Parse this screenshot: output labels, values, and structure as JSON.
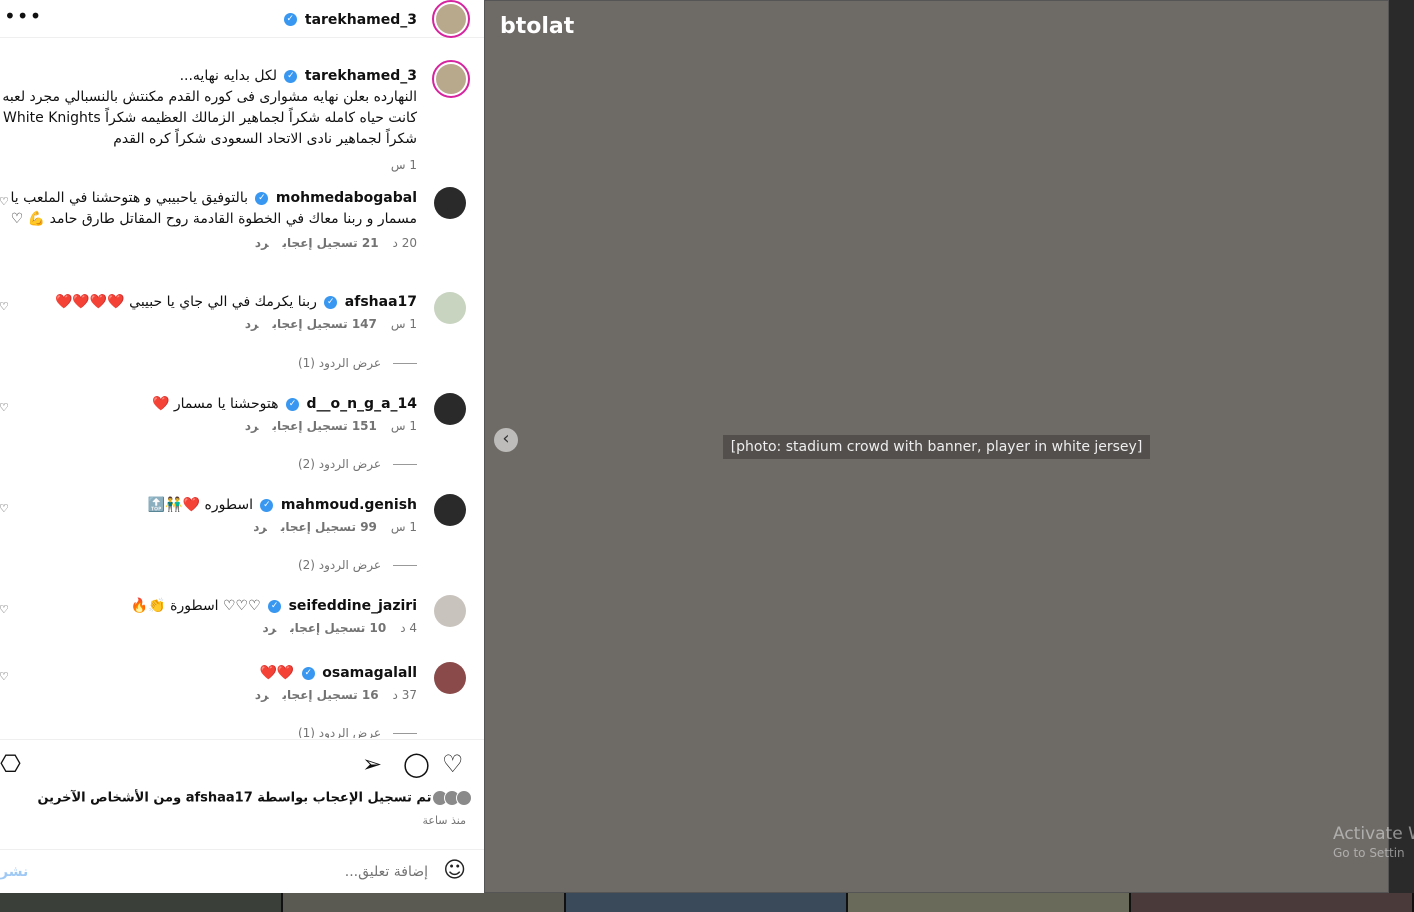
{
  "header": {
    "username": "tarekhamed_3",
    "more_icon": "more-dots-icon"
  },
  "caption": {
    "username": "tarekhamed_3",
    "lines": [
      "لكل بدايه نهايه...",
      "النهارده بعلن نهايه مشوارى فى كوره القدم مكنتش بالنسبالي مجرد لعبه",
      "كانت حياه كامله شكراً لجماهير الزمالك العظيمه شكراً White Knights",
      "شكراً لجماهير نادى الاتحاد السعودى شكراً كره القدم"
    ],
    "time": "1 س"
  },
  "comments": [
    {
      "username": "mohmedabogabal",
      "text": "بالتوفيق ياحبيبي و هتوحشنا في الملعب يا مسمار و ربنا معاك في الخطوة القادمة روح المقاتل طارق حامد 💪 ♡",
      "time": "20 د",
      "likes": "21 تسجيل إعجاب",
      "reply": "رد"
    },
    {
      "username": "afshaa17",
      "text": "ربنا يكرمك في الي جاي يا حبيبي ❤️❤️❤️❤️",
      "time": "1 س",
      "likes": "147 تسجيل إعجاب",
      "reply": "رد",
      "replies": "عرض الردود (1)"
    },
    {
      "username": "d__o_n_g_a_14",
      "text": "هتوحشنا يا مسمار ❤️",
      "time": "1 س",
      "likes": "151 تسجيل إعجاب",
      "reply": "رد",
      "replies": "عرض الردود (2)"
    },
    {
      "username": "mahmoud.genish",
      "text": "اسطوره ❤️👬🔝",
      "time": "1 س",
      "likes": "99 تسجيل إعجاب",
      "reply": "رد",
      "replies": "عرض الردود (2)"
    },
    {
      "username": "seifeddine_jaziri",
      "text": "♡♡♡ اسطورة 👏🔥",
      "time": "4 د",
      "likes": "10 تسجيل إعجاب",
      "reply": "رد"
    },
    {
      "username": "osamagalall",
      "text": "❤️❤️",
      "time": "37 د",
      "likes": "16 تسجيل إعجاب",
      "reply": "رد"
    }
  ],
  "partial_replies": "عرض الردود (1)",
  "actions": {
    "like_icon": "heart-icon",
    "comment_icon": "comment-icon",
    "share_icon": "share-icon",
    "save_icon": "bookmark-icon"
  },
  "likes_summary": {
    "prefix": "تم تسجيل الإعجاب بواسطة ",
    "user": "afshaa17",
    "suffix": " ومن الأشخاص الآخرين"
  },
  "time_ago": "منذ ساعة",
  "add_comment": {
    "placeholder": "إضافة تعليق...",
    "post": "نشر",
    "emoji_icon": "emoji-icon"
  },
  "photo": {
    "label": "[photo: stadium crowd with banner, player in white jersey]",
    "logo": "btolat"
  },
  "watermark": {
    "line1": "Activate W",
    "line2": "Go to Settin"
  },
  "colors": {
    "verified": "#3897f0",
    "post_button": "#9fc9f5",
    "meta": "#737373"
  }
}
